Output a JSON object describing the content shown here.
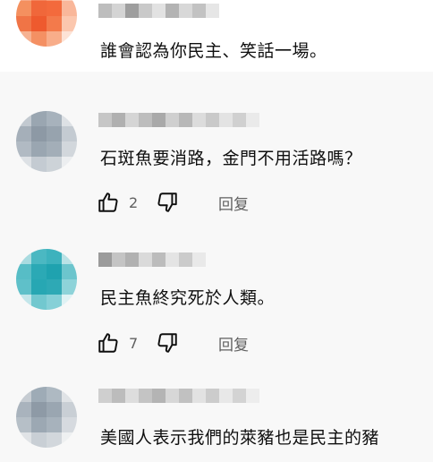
{
  "comments": [
    {
      "text": "誰會認為你民主、笑話一場。"
    },
    {
      "text": "石斑魚要消路，金門不用活路嗎？",
      "likes": "2",
      "reply_label": "回复"
    },
    {
      "text": "民主魚終究死於人類。",
      "likes": "7",
      "reply_label": "回复"
    },
    {
      "text": "美國人表示我們的萊豬也是民主的豬"
    }
  ],
  "colors": {
    "background": "#f8f8f8",
    "text": "#0f0f0f",
    "secondary_text": "#606060",
    "avatar_orange": "#f0673a",
    "avatar_teal": "#2ba9b5",
    "avatar_gray": "#9aa7b3"
  },
  "icons": [
    "thumbs-up-icon",
    "thumbs-down-icon"
  ]
}
